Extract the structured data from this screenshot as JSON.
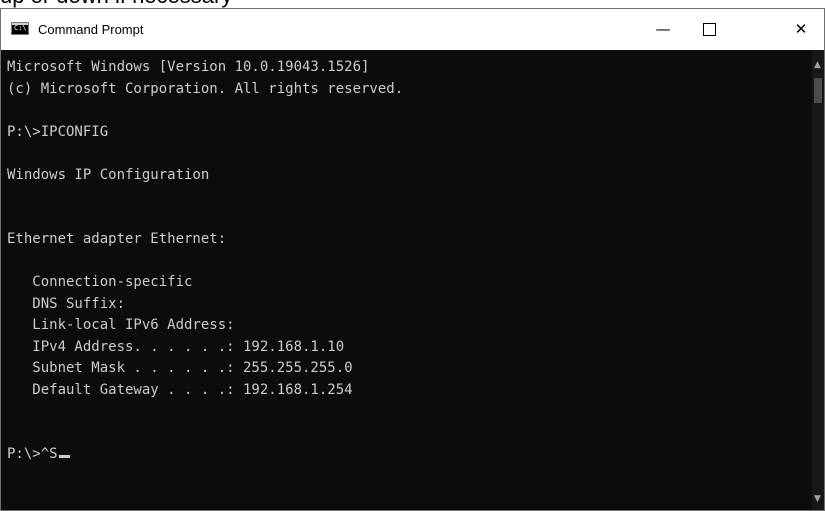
{
  "page_caption_clipped": "up or down if necessary",
  "window": {
    "title": "Command Prompt",
    "icon_text": "C:\\",
    "controls": {
      "minimize_icon": "minimize-icon",
      "maximize_icon": "maximize-icon",
      "close_icon": "close-icon",
      "minimize_glyph": "—",
      "close_glyph": "✕"
    }
  },
  "console": {
    "lines": [
      "Microsoft Windows [Version 10.0.19043.1526]",
      "(c) Microsoft Corporation. All rights reserved.",
      "",
      "P:\\>IPCONFIG",
      "",
      "Windows IP Configuration",
      "",
      "",
      "Ethernet adapter Ethernet:",
      "",
      "   Connection-specific",
      "   DNS Suffix:",
      "   Link-local IPv6 Address:",
      "   IPv4 Address. . . . . .: 192.168.1.10",
      "   Subnet Mask . . . . . .: 255.255.255.0",
      "   Default Gateway . . . .: 192.168.1.254",
      "",
      "",
      "P:\\>^S"
    ],
    "cursor_visible": true
  },
  "colors": {
    "console_bg": "#0c0c0c",
    "console_fg": "#cccccc",
    "titlebar_bg": "#ffffff"
  }
}
